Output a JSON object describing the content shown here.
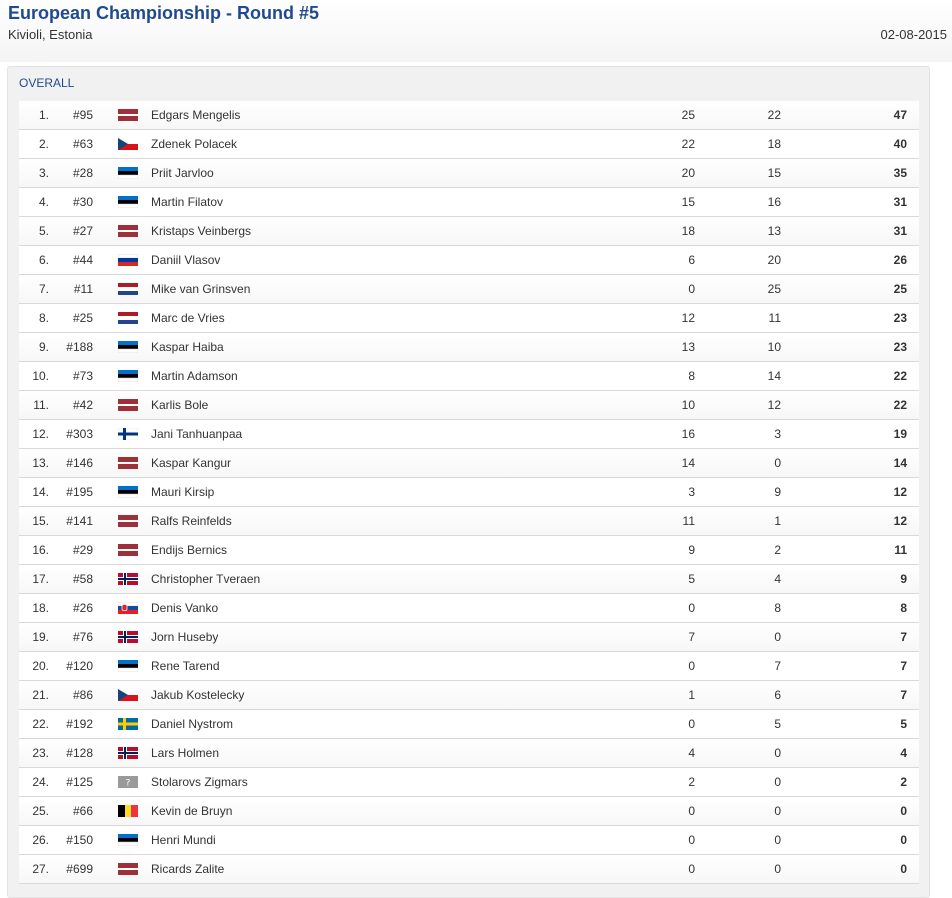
{
  "header": {
    "title": "European Championship - Round #5",
    "location": "Kivioli, Estonia",
    "date": "02-08-2015"
  },
  "section": {
    "title": "OVERALL"
  },
  "rows": [
    {
      "pos": "1.",
      "num": "#95",
      "flag": "latvia",
      "name": "Edgars Mengelis",
      "r1": "25",
      "r2": "22",
      "total": "47"
    },
    {
      "pos": "2.",
      "num": "#63",
      "flag": "czech",
      "name": "Zdenek Polacek",
      "r1": "22",
      "r2": "18",
      "total": "40"
    },
    {
      "pos": "3.",
      "num": "#28",
      "flag": "estonia",
      "name": "Priit Jarvloo",
      "r1": "20",
      "r2": "15",
      "total": "35"
    },
    {
      "pos": "4.",
      "num": "#30",
      "flag": "estonia",
      "name": "Martin Filatov",
      "r1": "15",
      "r2": "16",
      "total": "31"
    },
    {
      "pos": "5.",
      "num": "#27",
      "flag": "latvia",
      "name": "Kristaps Veinbergs",
      "r1": "18",
      "r2": "13",
      "total": "31"
    },
    {
      "pos": "6.",
      "num": "#44",
      "flag": "russia",
      "name": "Daniil Vlasov",
      "r1": "6",
      "r2": "20",
      "total": "26"
    },
    {
      "pos": "7.",
      "num": "#11",
      "flag": "netherlands",
      "name": "Mike van Grinsven",
      "r1": "0",
      "r2": "25",
      "total": "25"
    },
    {
      "pos": "8.",
      "num": "#25",
      "flag": "netherlands",
      "name": "Marc de Vries",
      "r1": "12",
      "r2": "11",
      "total": "23"
    },
    {
      "pos": "9.",
      "num": "#188",
      "flag": "estonia",
      "name": "Kaspar Haiba",
      "r1": "13",
      "r2": "10",
      "total": "23"
    },
    {
      "pos": "10.",
      "num": "#73",
      "flag": "estonia",
      "name": "Martin Adamson",
      "r1": "8",
      "r2": "14",
      "total": "22"
    },
    {
      "pos": "11.",
      "num": "#42",
      "flag": "latvia",
      "name": "Karlis Bole",
      "r1": "10",
      "r2": "12",
      "total": "22"
    },
    {
      "pos": "12.",
      "num": "#303",
      "flag": "finland",
      "name": "Jani Tanhuanpaa",
      "r1": "16",
      "r2": "3",
      "total": "19"
    },
    {
      "pos": "13.",
      "num": "#146",
      "flag": "latvia",
      "name": "Kaspar Kangur",
      "r1": "14",
      "r2": "0",
      "total": "14"
    },
    {
      "pos": "14.",
      "num": "#195",
      "flag": "estonia",
      "name": "Mauri Kirsip",
      "r1": "3",
      "r2": "9",
      "total": "12"
    },
    {
      "pos": "15.",
      "num": "#141",
      "flag": "latvia",
      "name": "Ralfs Reinfelds",
      "r1": "11",
      "r2": "1",
      "total": "12"
    },
    {
      "pos": "16.",
      "num": "#29",
      "flag": "latvia",
      "name": "Endijs Bernics",
      "r1": "9",
      "r2": "2",
      "total": "11"
    },
    {
      "pos": "17.",
      "num": "#58",
      "flag": "norway",
      "name": "Christopher Tveraen",
      "r1": "5",
      "r2": "4",
      "total": "9"
    },
    {
      "pos": "18.",
      "num": "#26",
      "flag": "slovakia",
      "name": "Denis Vanko",
      "r1": "0",
      "r2": "8",
      "total": "8"
    },
    {
      "pos": "19.",
      "num": "#76",
      "flag": "norway",
      "name": "Jorn Huseby",
      "r1": "7",
      "r2": "0",
      "total": "7"
    },
    {
      "pos": "20.",
      "num": "#120",
      "flag": "estonia",
      "name": "Rene Tarend",
      "r1": "0",
      "r2": "7",
      "total": "7"
    },
    {
      "pos": "21.",
      "num": "#86",
      "flag": "czech",
      "name": "Jakub Kostelecky",
      "r1": "1",
      "r2": "6",
      "total": "7"
    },
    {
      "pos": "22.",
      "num": "#192",
      "flag": "sweden",
      "name": "Daniel Nystrom",
      "r1": "0",
      "r2": "5",
      "total": "5"
    },
    {
      "pos": "23.",
      "num": "#128",
      "flag": "norway",
      "name": "Lars Holmen",
      "r1": "4",
      "r2": "0",
      "total": "4"
    },
    {
      "pos": "24.",
      "num": "#125",
      "flag": "unknown",
      "name": "Stolarovs Zigmars",
      "r1": "2",
      "r2": "0",
      "total": "2"
    },
    {
      "pos": "25.",
      "num": "#66",
      "flag": "belgium",
      "name": "Kevin de Bruyn",
      "r1": "0",
      "r2": "0",
      "total": "0"
    },
    {
      "pos": "26.",
      "num": "#150",
      "flag": "estonia",
      "name": "Henri Mundi",
      "r1": "0",
      "r2": "0",
      "total": "0"
    },
    {
      "pos": "27.",
      "num": "#699",
      "flag": "latvia",
      "name": "Ricards Zalite",
      "r1": "0",
      "r2": "0",
      "total": "0"
    }
  ]
}
